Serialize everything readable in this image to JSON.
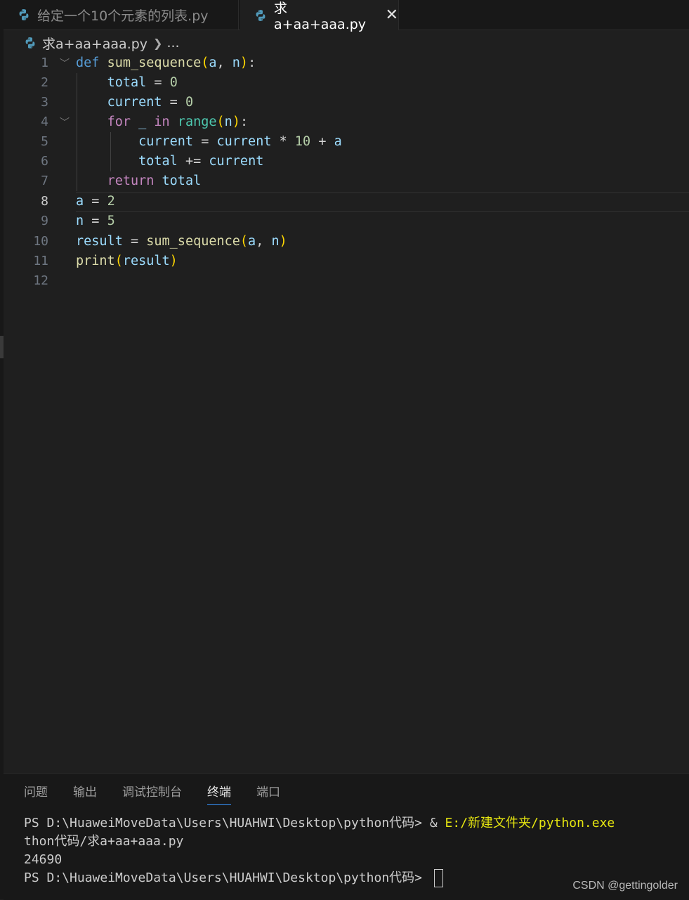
{
  "tabs": [
    {
      "label": "给定一个10个元素的列表.py",
      "active": false
    },
    {
      "label": "求a+aa+aaa.py",
      "active": true,
      "close": "✕"
    }
  ],
  "breadcrumb": {
    "file": "求a+aa+aaa.py",
    "more": "..."
  },
  "editor": {
    "line_numbers": [
      "1",
      "2",
      "3",
      "4",
      "5",
      "6",
      "7",
      "8",
      "9",
      "10",
      "11",
      "12"
    ],
    "current_line": 8
  },
  "panel": {
    "tabs": [
      "问题",
      "输出",
      "调试控制台",
      "终端",
      "端口"
    ],
    "active_tab": "终端",
    "terminal": {
      "line1_prompt": "PS D:\\HuaweiMoveData\\Users\\HUAHWI\\Desktop\\python代码> & ",
      "line1_cmd": "E:/新建文件夹/python.exe",
      "line2": "thon代码/求a+aa+aaa.py",
      "line3": "24690",
      "line4_prompt": "PS D:\\HuaweiMoveData\\Users\\HUAHWI\\Desktop\\python代码> "
    }
  },
  "watermark": "CSDN @gettingolder",
  "colors": {
    "keyword": "#569cd6",
    "control": "#c586c0",
    "function": "#dcdcaa",
    "variable": "#9cdcfe",
    "number": "#b5cea8",
    "builtin": "#4ec9b0"
  }
}
